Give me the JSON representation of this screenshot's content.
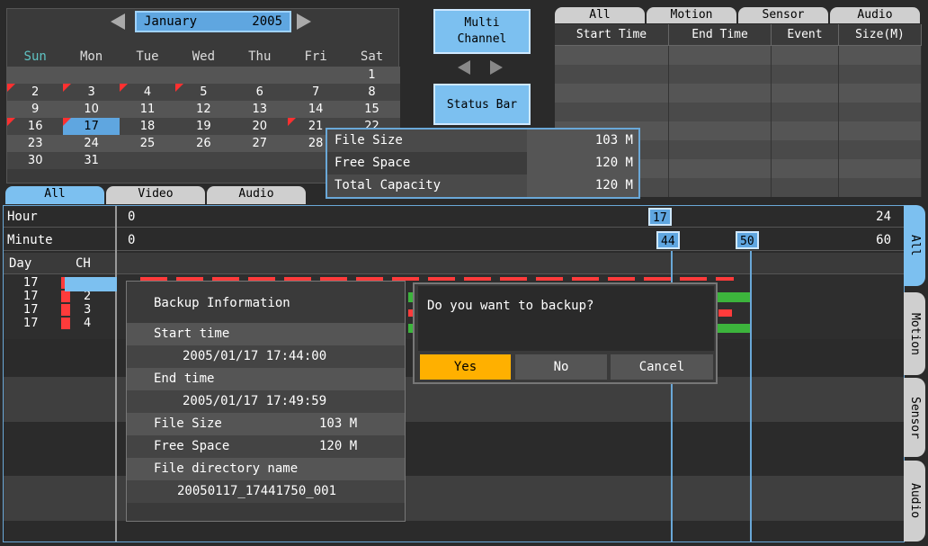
{
  "calendar": {
    "month": "January",
    "year": "2005",
    "weekdays": [
      "Sun",
      "Mon",
      "Tue",
      "Wed",
      "Thu",
      "Fri",
      "Sat"
    ],
    "weeks": [
      [
        "",
        "",
        "",
        "",
        "",
        "",
        "1"
      ],
      [
        "2",
        "3",
        "4",
        "5",
        "6",
        "7",
        "8"
      ],
      [
        "9",
        "10",
        "11",
        "12",
        "13",
        "14",
        "15"
      ],
      [
        "16",
        "17",
        "18",
        "19",
        "20",
        "21",
        "22"
      ],
      [
        "23",
        "24",
        "25",
        "26",
        "27",
        "28",
        "29"
      ],
      [
        "30",
        "31",
        "",
        "",
        "",
        "",
        ""
      ]
    ],
    "selected_day": "17",
    "recorded_days": [
      "2",
      "3",
      "4",
      "5",
      "16",
      "17",
      "21"
    ]
  },
  "controls": {
    "multi_channel_line1": "Multi",
    "multi_channel_line2": "Channel",
    "status_bar": "Status Bar"
  },
  "event_list": {
    "tabs": [
      "All",
      "Motion",
      "Sensor",
      "Audio"
    ],
    "columns": [
      "Start Time",
      "End Time",
      "Event",
      "Size(M)"
    ],
    "row_count": 8
  },
  "size_popup": {
    "rows": [
      {
        "label": "File Size",
        "value": "103 M"
      },
      {
        "label": "Free Space",
        "value": "120 M"
      },
      {
        "label": "Total Capacity",
        "value": "120 M"
      }
    ]
  },
  "timeline": {
    "tabs": [
      "All",
      "Video",
      "Audio"
    ],
    "hour_label": "Hour",
    "hour_start": "0",
    "hour_end": "24",
    "hour_marker": "17",
    "minute_label": "Minute",
    "minute_start": "0",
    "minute_end": "60",
    "minute_marker_start": "44",
    "minute_marker_end": "50",
    "day_header": "Day",
    "ch_header": "CH",
    "channels": [
      {
        "day": "17",
        "ch": "1"
      },
      {
        "day": "17",
        "ch": "2"
      },
      {
        "day": "17",
        "ch": "3"
      },
      {
        "day": "17",
        "ch": "4"
      }
    ],
    "side_tabs": [
      "All",
      "Motion",
      "Sensor",
      "Audio"
    ],
    "colors": {
      "record": "#ff3b3b",
      "audio": "#3cb43c",
      "accent": "#5fa6e0"
    }
  },
  "backup_info": {
    "title": "Backup Information",
    "start_label": "Start time",
    "start_value": "2005/01/17  17:44:00",
    "end_label": "End time",
    "end_value": "2005/01/17  17:49:59",
    "file_size_label": "File Size",
    "file_size_value": "103 M",
    "free_space_label": "Free Space",
    "free_space_value": "120 M",
    "dir_label": "File directory name",
    "dir_value": "20050117_17441750_001"
  },
  "dialog": {
    "message": "Do you want to backup?",
    "yes": "Yes",
    "no": "No",
    "cancel": "Cancel"
  }
}
